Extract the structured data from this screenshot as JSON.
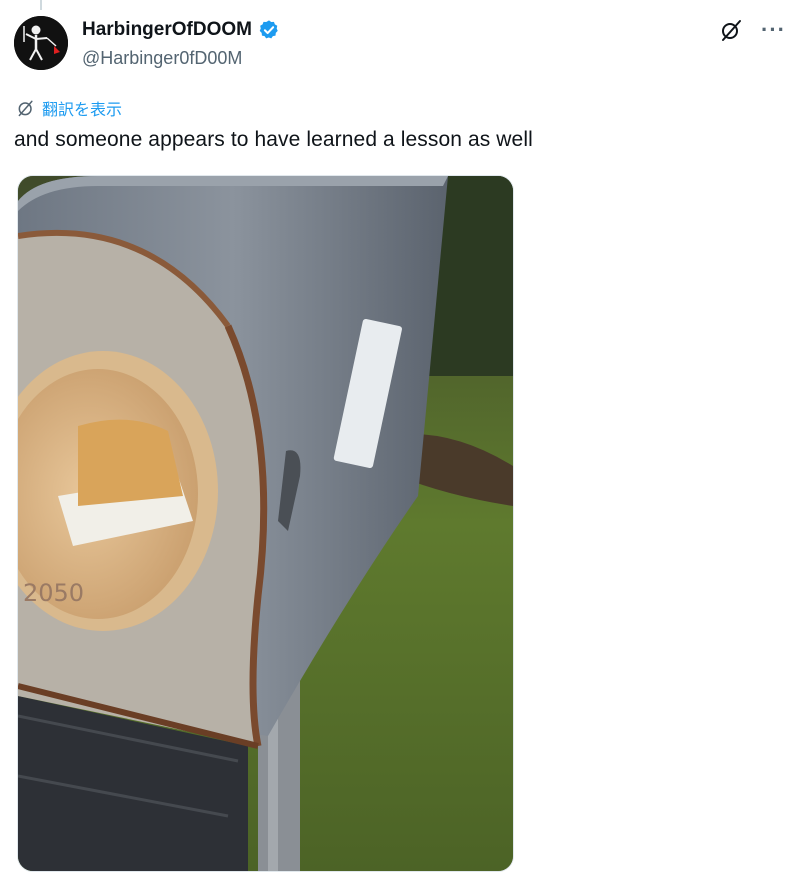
{
  "tweet": {
    "display_name": "HarbingerOfDOOM",
    "handle": "@Harbinger0fD00M",
    "translate_label": "翻訳を表示",
    "text": "and someone appears to have learned a lesson as well",
    "more_label": "···",
    "mailbox_number": "2050"
  },
  "icons": {
    "verified": "verified-badge-icon",
    "grok": "grok-icon",
    "more": "more-icon",
    "translate": "globe-translate-icon"
  },
  "colors": {
    "accent": "#1d9bf0",
    "text": "#0f1419",
    "secondary": "#536471"
  }
}
